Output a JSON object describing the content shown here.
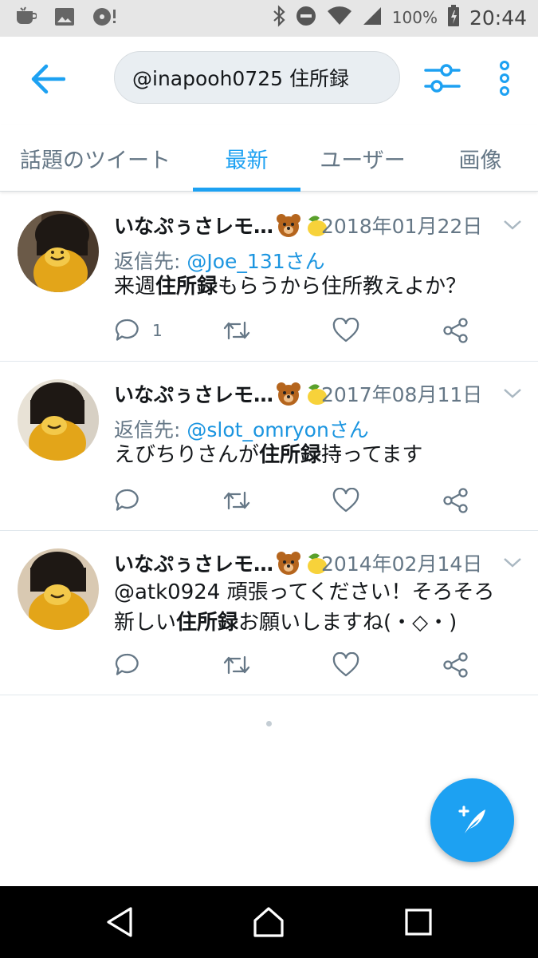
{
  "status_bar": {
    "battery": "100%",
    "time": "20:44",
    "icons": [
      "app-notification-icon",
      "image-notification-icon",
      "media-notification-icon",
      "bluetooth-icon",
      "do-not-disturb-icon",
      "wifi-icon",
      "signal-icon",
      "battery-icon"
    ]
  },
  "header": {
    "search_value": "@inapooh0725 住所録",
    "icons": [
      "back-arrow-icon",
      "filter-sliders-icon",
      "more-vert-icon"
    ]
  },
  "tabs": [
    {
      "label": "話題のツイート",
      "active": false
    },
    {
      "label": "最新",
      "active": true
    },
    {
      "label": "ユーザー",
      "active": false
    },
    {
      "label": "画像",
      "active": false
    }
  ],
  "tweets": [
    {
      "name": "いなぷぅさレモ…",
      "date": "2018年01月22日",
      "reply_prefix": "返信先: ",
      "reply_to": "@Joe_131さん",
      "text_before": "来週",
      "text_bold": "住所録",
      "text_after": "もらうから住所教えよか？",
      "reply_count": "1"
    },
    {
      "name": "いなぷぅさレモ…",
      "date": "2017年08月11日",
      "reply_prefix": "返信先: ",
      "reply_to": "@slot_omryonさん",
      "text_before": "えびちりさんが",
      "text_bold": "住所録",
      "text_after": "持ってます",
      "reply_count": ""
    },
    {
      "name": "いなぷぅさレモ…",
      "date": "2014年02月14日",
      "line1": "@atk0924 頑張ってください！そろそろ",
      "line2_before": "新しい",
      "line2_bold": "住所録",
      "line2_after": "お願いしますね(・◇・)",
      "reply_count": ""
    }
  ],
  "colors": {
    "accent": "#1da1f2",
    "link": "#1b95e0",
    "secondary_text": "#657786",
    "status_bar_bg": "#e6e6e6",
    "nav_bar_bg": "#000000"
  }
}
